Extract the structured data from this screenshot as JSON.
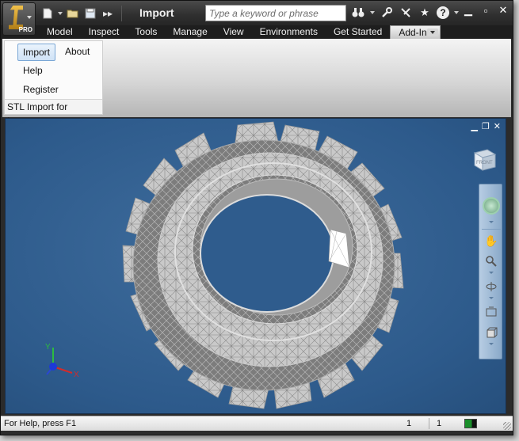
{
  "window": {
    "title": "Import",
    "app_badge": "PRO"
  },
  "search": {
    "placeholder": "Type a keyword or phrase"
  },
  "menu": {
    "tabs": [
      {
        "label": "Model"
      },
      {
        "label": "Inspect"
      },
      {
        "label": "Tools"
      },
      {
        "label": "Manage"
      },
      {
        "label": "View"
      },
      {
        "label": "Environments"
      },
      {
        "label": "Get Started"
      },
      {
        "label": "Add-Ins"
      }
    ],
    "active_tab": "Add-Ins"
  },
  "ribbon": {
    "panel": {
      "title": "STL Import for Inventor",
      "buttons": [
        {
          "label": "Import"
        },
        {
          "label": "About"
        },
        {
          "label": "Help"
        },
        {
          "label": "Register"
        }
      ]
    }
  },
  "viewport": {
    "background_color": "#2d5a8b",
    "viewcube_face": "FRONT",
    "triad": {
      "x": "X",
      "y": "Y"
    }
  },
  "status": {
    "help_text": "For Help, press F1",
    "value_1": "1",
    "value_2": "1"
  },
  "icons": [
    "app-menu-icon",
    "new-file-icon",
    "open-folder-icon",
    "save-icon",
    "more-icon",
    "binoculars-icon",
    "wrench-icon",
    "tools-icon",
    "star-icon",
    "help-icon",
    "minimize-icon",
    "maximize-icon",
    "close-icon",
    "steering-wheel-icon",
    "pan-hand-icon",
    "zoom-icon",
    "orbit-icon",
    "look-at-icon",
    "view-cube-icon"
  ]
}
